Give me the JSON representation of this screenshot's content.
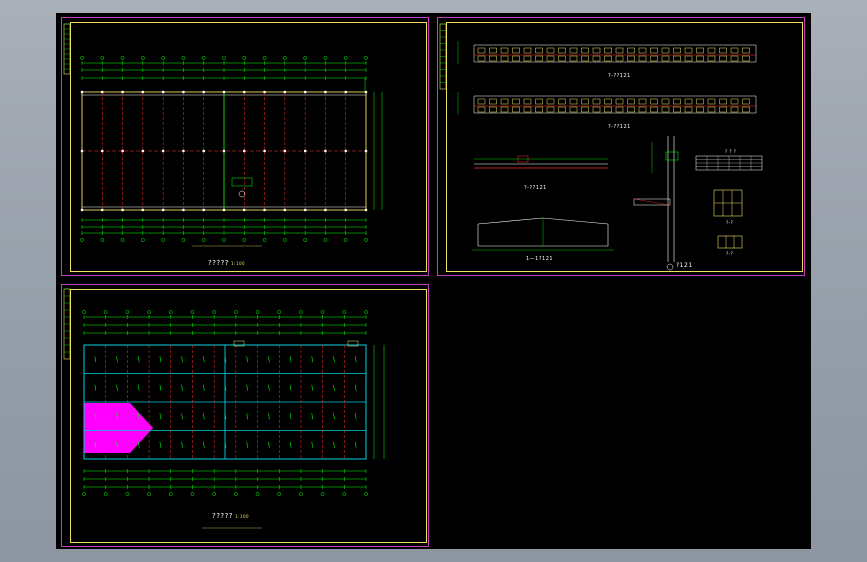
{
  "colors": {
    "background": "#a4abb5",
    "canvas": "#000000",
    "sheet_border": "#c040c0",
    "frame": "#f0e060",
    "grid_axis": "#00ff00",
    "dim_line": "#00ff00",
    "column_line": "#ff3030",
    "beam": "#00d0e0",
    "hatch": "#ff00ff",
    "text": "#ffffff"
  },
  "sheets": {
    "plan_top": {
      "title": "?????",
      "scale": "1:100"
    },
    "elevations": {
      "elev1_label": "?-??121",
      "elev2_label": "?-??121",
      "section1_label": "?-??121",
      "section2_label": "1—1?121",
      "detail_label": "?121",
      "table_title": "? ? ?",
      "window1_label": "?-?",
      "window2_label": "?-?"
    },
    "plan_bottom": {
      "title": "?????",
      "scale": "1:100"
    }
  }
}
